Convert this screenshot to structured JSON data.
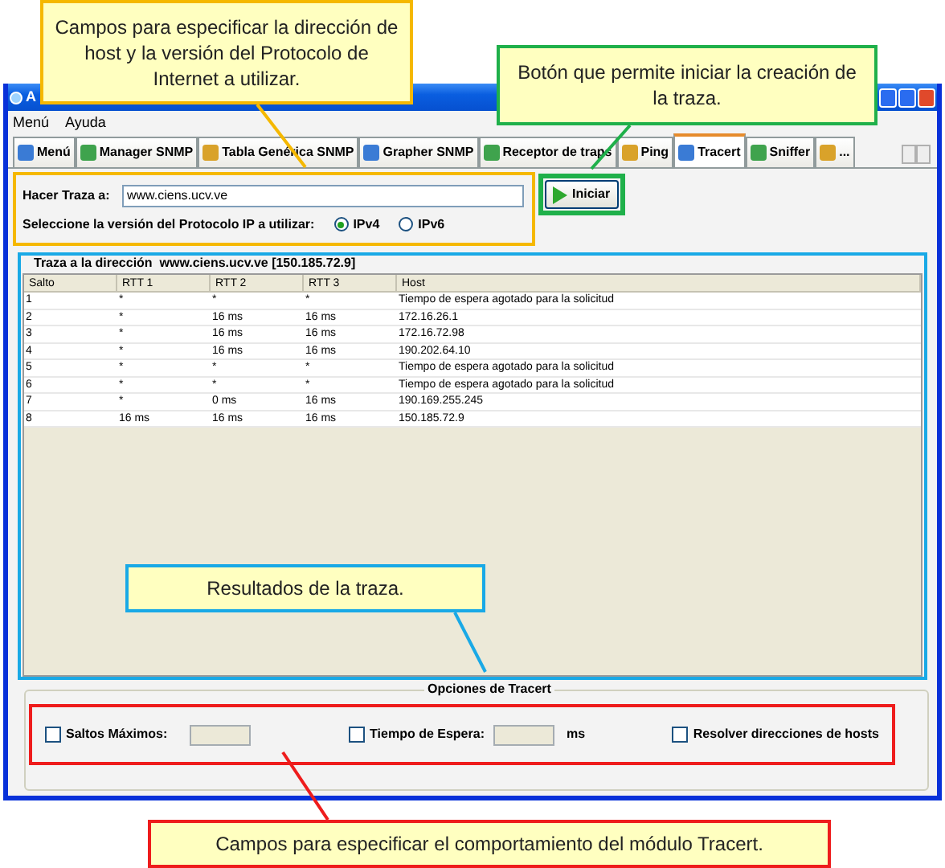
{
  "window": {
    "title": "A"
  },
  "menu": [
    "Menú",
    "Ayuda"
  ],
  "tabs": [
    {
      "label": "Menú",
      "selected": false
    },
    {
      "label": "Manager SNMP",
      "selected": false
    },
    {
      "label": "Tabla Genérica SNMP",
      "selected": false
    },
    {
      "label": "Grapher SNMP",
      "selected": false
    },
    {
      "label": "Receptor de traps",
      "selected": false
    },
    {
      "label": "Ping",
      "selected": false
    },
    {
      "label": "Tracert",
      "selected": true
    },
    {
      "label": "Sniffer",
      "selected": false
    },
    {
      "label": "...",
      "selected": false
    }
  ],
  "trace_form": {
    "host_label": "Hacer Traza a:",
    "host_value": "www.ciens.ucv.ve",
    "version_label": "Seleccione la versión del Protocolo IP a utilizar:",
    "versions": [
      {
        "label": "IPv4",
        "selected": true
      },
      {
        "label": "IPv6",
        "selected": false
      }
    ],
    "start_button": "Iniciar"
  },
  "results": {
    "title": "Traza a la dirección  www.ciens.ucv.ve [150.185.72.9]",
    "columns": [
      "Salto",
      "RTT 1",
      "RTT 2",
      "RTT 3",
      "Host"
    ],
    "rows": [
      [
        "1",
        "*",
        "*",
        "*",
        "Tiempo de espera agotado para la solicitud"
      ],
      [
        "2",
        "*",
        "16 ms",
        "16 ms",
        "172.16.26.1"
      ],
      [
        "3",
        "*",
        "16 ms",
        "16 ms",
        "172.16.72.98"
      ],
      [
        "4",
        "*",
        "16 ms",
        "16 ms",
        "190.202.64.10"
      ],
      [
        "5",
        "*",
        "*",
        "*",
        "Tiempo de espera agotado para la solicitud"
      ],
      [
        "6",
        "*",
        "*",
        "*",
        "Tiempo de espera agotado para la solicitud"
      ],
      [
        "7",
        "*",
        "0 ms",
        "16 ms",
        "190.169.255.245"
      ],
      [
        "8",
        "16 ms",
        "16 ms",
        "16 ms",
        "150.185.72.9"
      ]
    ]
  },
  "options": {
    "title": "Opciones de Tracert",
    "items": [
      {
        "kind": "field",
        "label": "Saltos Máximos:",
        "checked": false
      },
      {
        "kind": "field",
        "label": "Tiempo de Espera:",
        "checked": false,
        "unit": "ms"
      },
      {
        "kind": "check",
        "label": "Resolver direcciones de hosts",
        "checked": false
      }
    ]
  },
  "callouts": [
    {
      "text": "Campos para especificar la dirección de host y la versión del Protocolo de Internet a utilizar.",
      "color": "#f5b800"
    },
    {
      "text": "Botón que permite iniciar la creación de la traza.",
      "color": "#1fb04a"
    },
    {
      "text": "Resultados de la traza.",
      "color": "#19a9e6"
    },
    {
      "text": "Campos para especificar el comportamiento del módulo Tracert.",
      "color": "#ee1c1c"
    }
  ]
}
